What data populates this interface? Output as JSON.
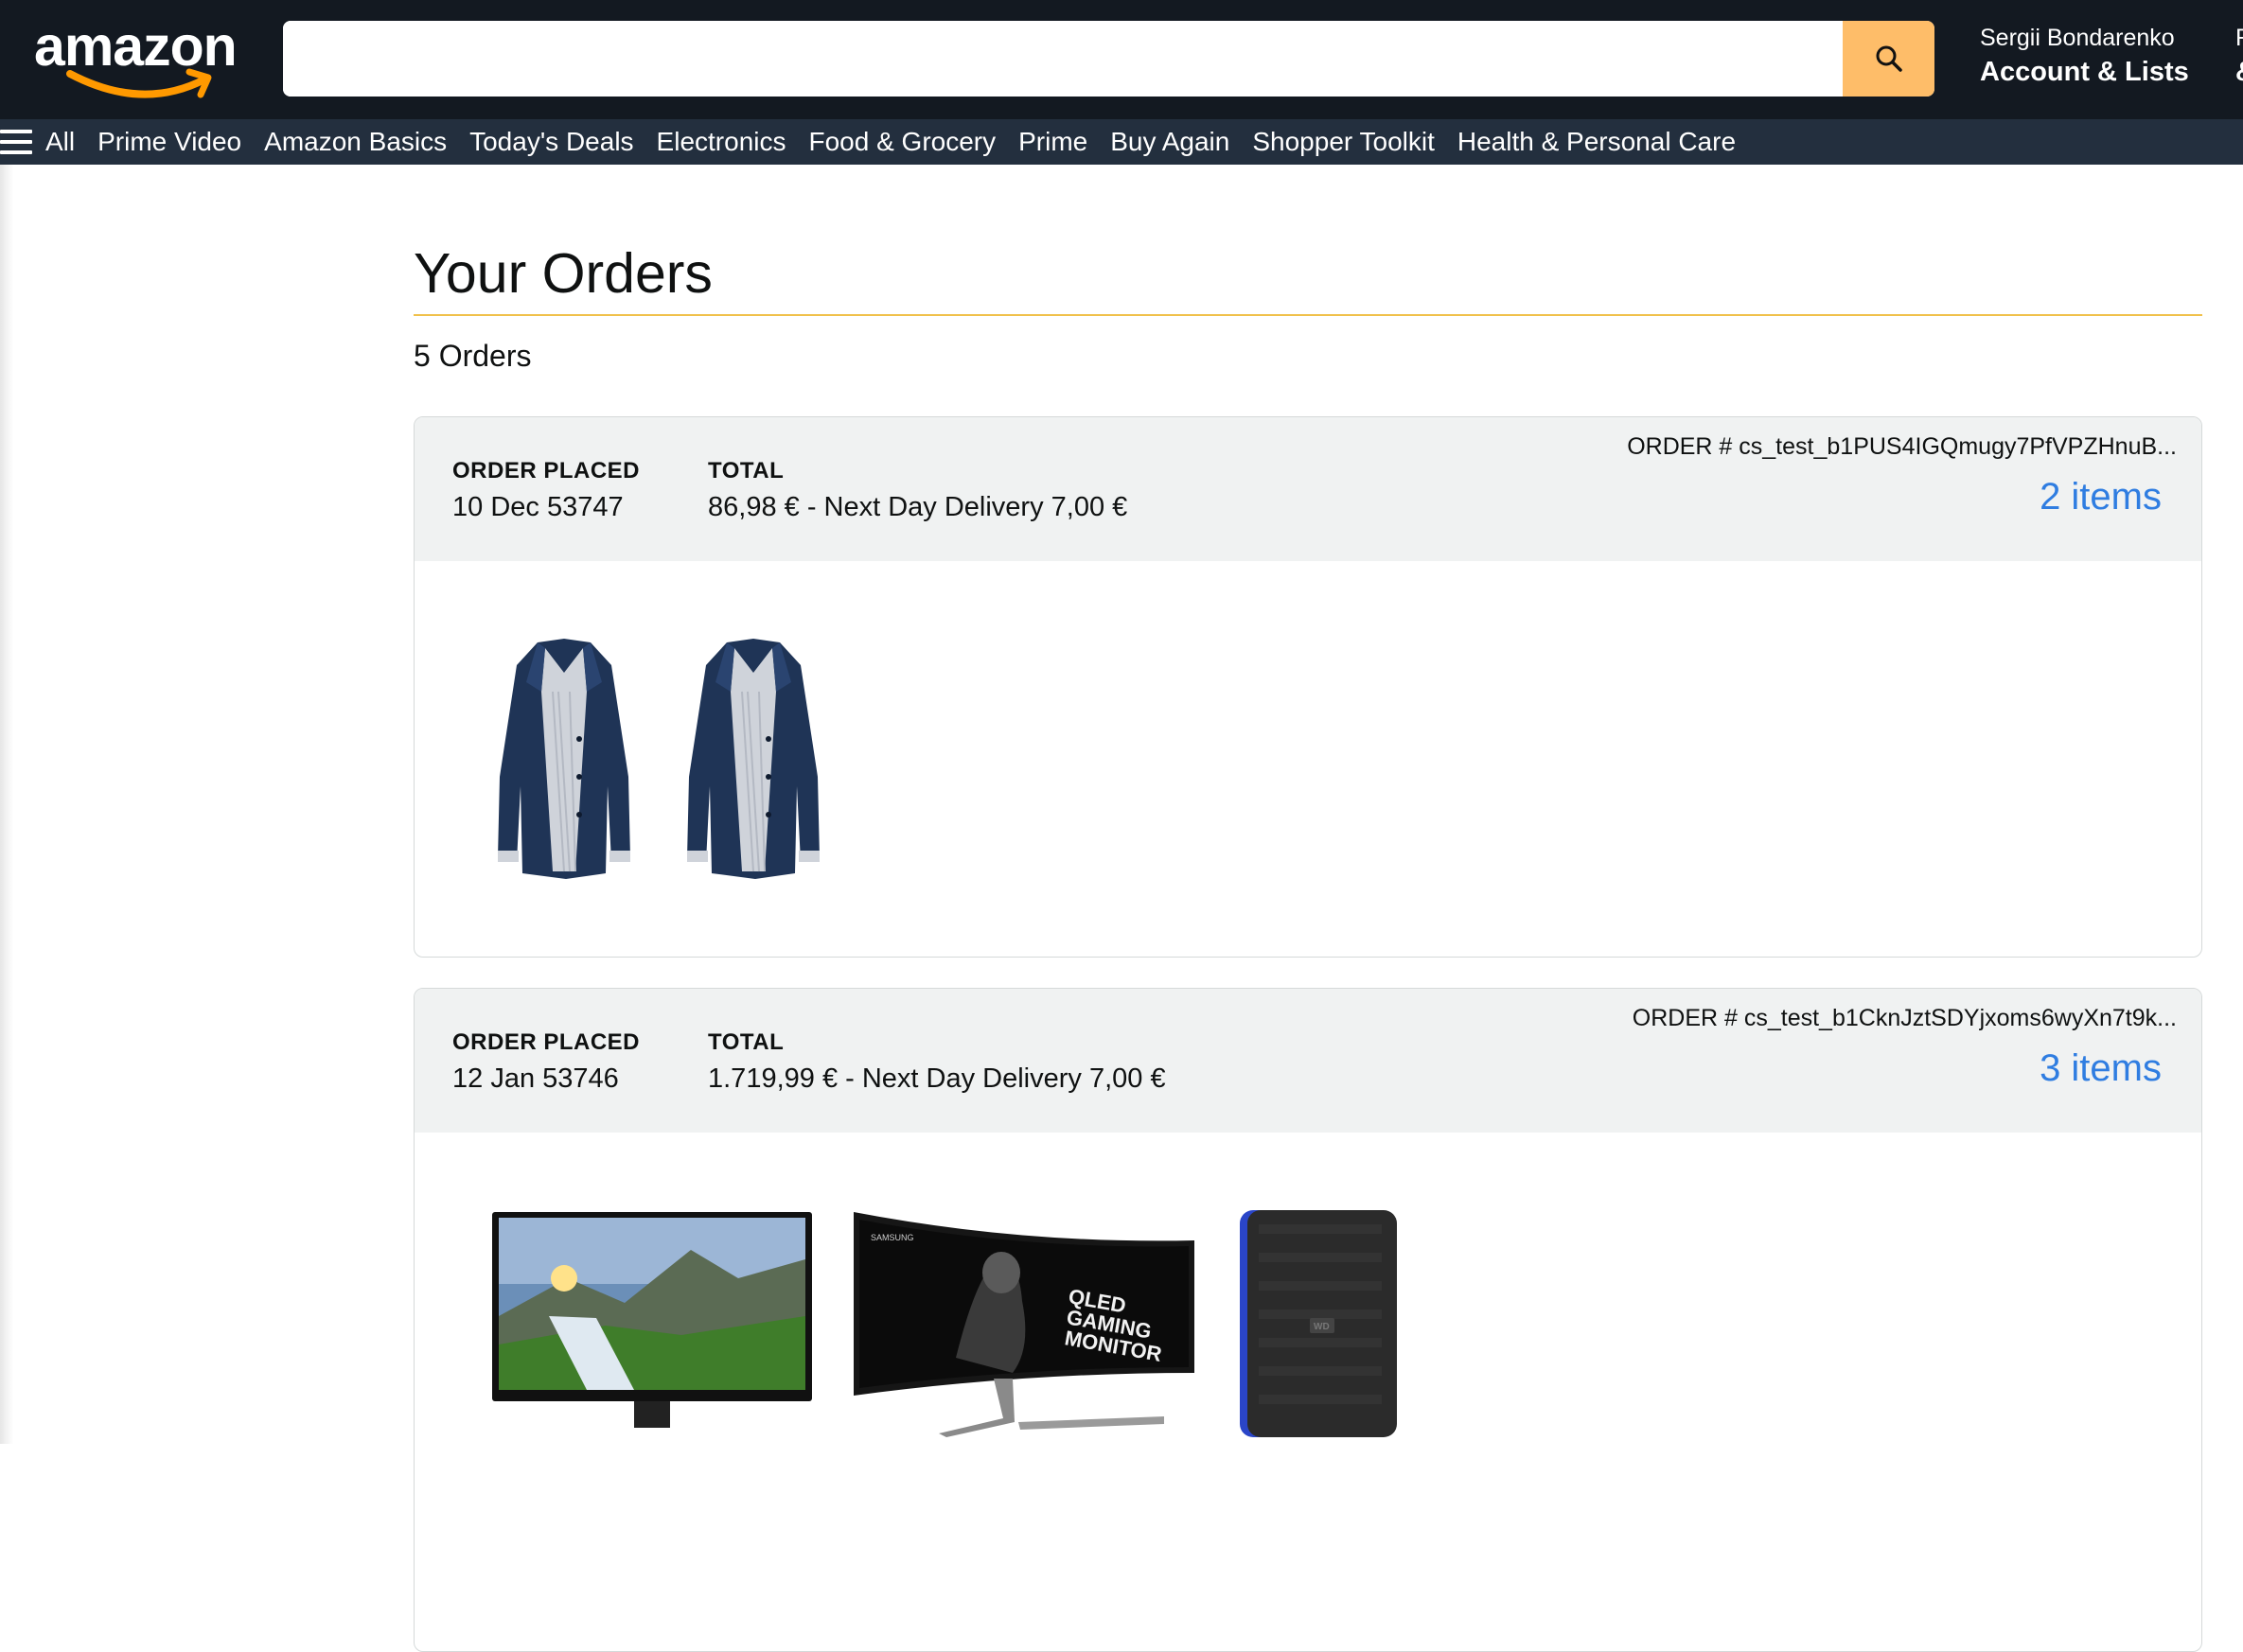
{
  "header": {
    "logo": "amazon",
    "search": {
      "value": "",
      "placeholder": ""
    },
    "account": {
      "greeting": "Sergii Bondarenko",
      "label": "Account & Lists"
    },
    "returns": {
      "line1": "R",
      "line2": "&"
    }
  },
  "nav": {
    "all_label": "All",
    "items": [
      "Prime Video",
      "Amazon Basics",
      "Today's Deals",
      "Electronics",
      "Food & Grocery",
      "Prime",
      "Buy Again",
      "Shopper Toolkit",
      "Health & Personal Care"
    ]
  },
  "page": {
    "title": "Your Orders",
    "order_count": "5 Orders"
  },
  "labels": {
    "order_placed": "ORDER PLACED",
    "total": "TOTAL"
  },
  "orders": [
    {
      "placed": "10 Dec 53747",
      "total": "86,98 € - Next Day Delivery 7,00 €",
      "order_id": "ORDER # cs_test_b1PUS4IGQmugy7PfVPZHnuB...",
      "items_link": "2 items",
      "products": [
        "navy-raincoat",
        "navy-raincoat"
      ]
    },
    {
      "placed": "12 Jan 53746",
      "total": "1.719,99 € - Next Day Delivery 7,00 €",
      "order_id": "ORDER # cs_test_b1CknJztSDYjxoms6wyXn7t9k...",
      "items_link": "3 items",
      "products": [
        "acer-monitor",
        "samsung-curved-qled-gaming-monitor",
        "wd-external-hard-drive"
      ],
      "product_texts": {
        "samsung_brand": "SAMSUNG",
        "qled": "QLED",
        "gaming": "GAMING",
        "monitor": "MONITOR",
        "wd": "WD"
      }
    }
  ],
  "colors": {
    "header_bg": "#131921",
    "nav_bg": "#232f3e",
    "search_button": "#febd69",
    "accent_rule": "#f0c14b",
    "link": "#2f7de1",
    "card_header": "#f0f2f2"
  }
}
